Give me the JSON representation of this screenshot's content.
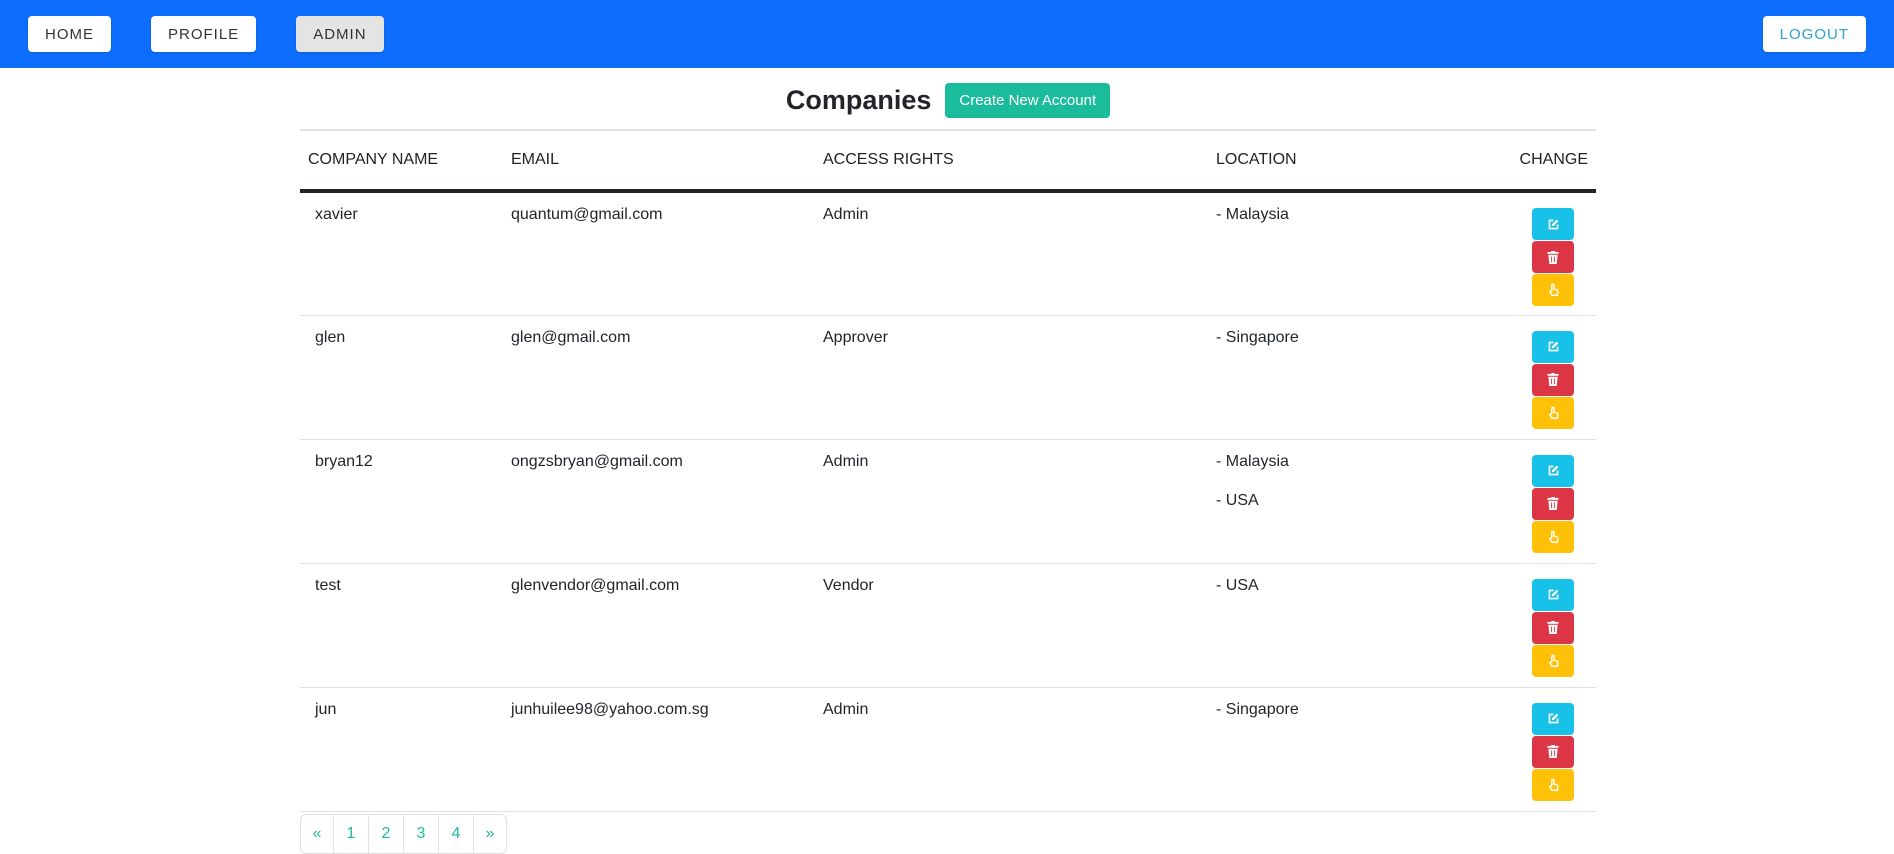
{
  "nav": {
    "home": "HOME",
    "profile": "PROFILE",
    "admin": "ADMIN",
    "logout": "LOGOUT"
  },
  "page": {
    "title": "Companies",
    "create_button": "Create New Account"
  },
  "table": {
    "headers": [
      "COMPANY NAME",
      "EMAIL",
      "ACCESS RIGHTS",
      "LOCATION",
      "CHANGE"
    ],
    "rows": [
      {
        "name": "xavier",
        "email": "quantum@gmail.com",
        "access": "Admin",
        "locations": [
          "- Malaysia"
        ]
      },
      {
        "name": "glen",
        "email": "glen@gmail.com",
        "access": "Approver",
        "locations": [
          "- Singapore"
        ]
      },
      {
        "name": "bryan12",
        "email": "ongzsbryan@gmail.com",
        "access": "Admin",
        "locations": [
          "- Malaysia",
          "- USA"
        ]
      },
      {
        "name": "test",
        "email": "glenvendor@gmail.com",
        "access": "Vendor",
        "locations": [
          "- USA"
        ]
      },
      {
        "name": "jun",
        "email": "junhuilee98@yahoo.com.sg",
        "access": "Admin",
        "locations": [
          "- Singapore"
        ]
      }
    ]
  },
  "pagination": [
    "«",
    "1",
    "2",
    "3",
    "4",
    "»"
  ],
  "icons": {
    "edit": "edit-icon",
    "delete": "trash-icon",
    "select": "pointer-hand-icon"
  },
  "colors": {
    "navbar": "#0d6efd",
    "create": "#1abc9c",
    "edit": "#17c1e8",
    "delete": "#dc3545",
    "select": "#ffc107"
  }
}
